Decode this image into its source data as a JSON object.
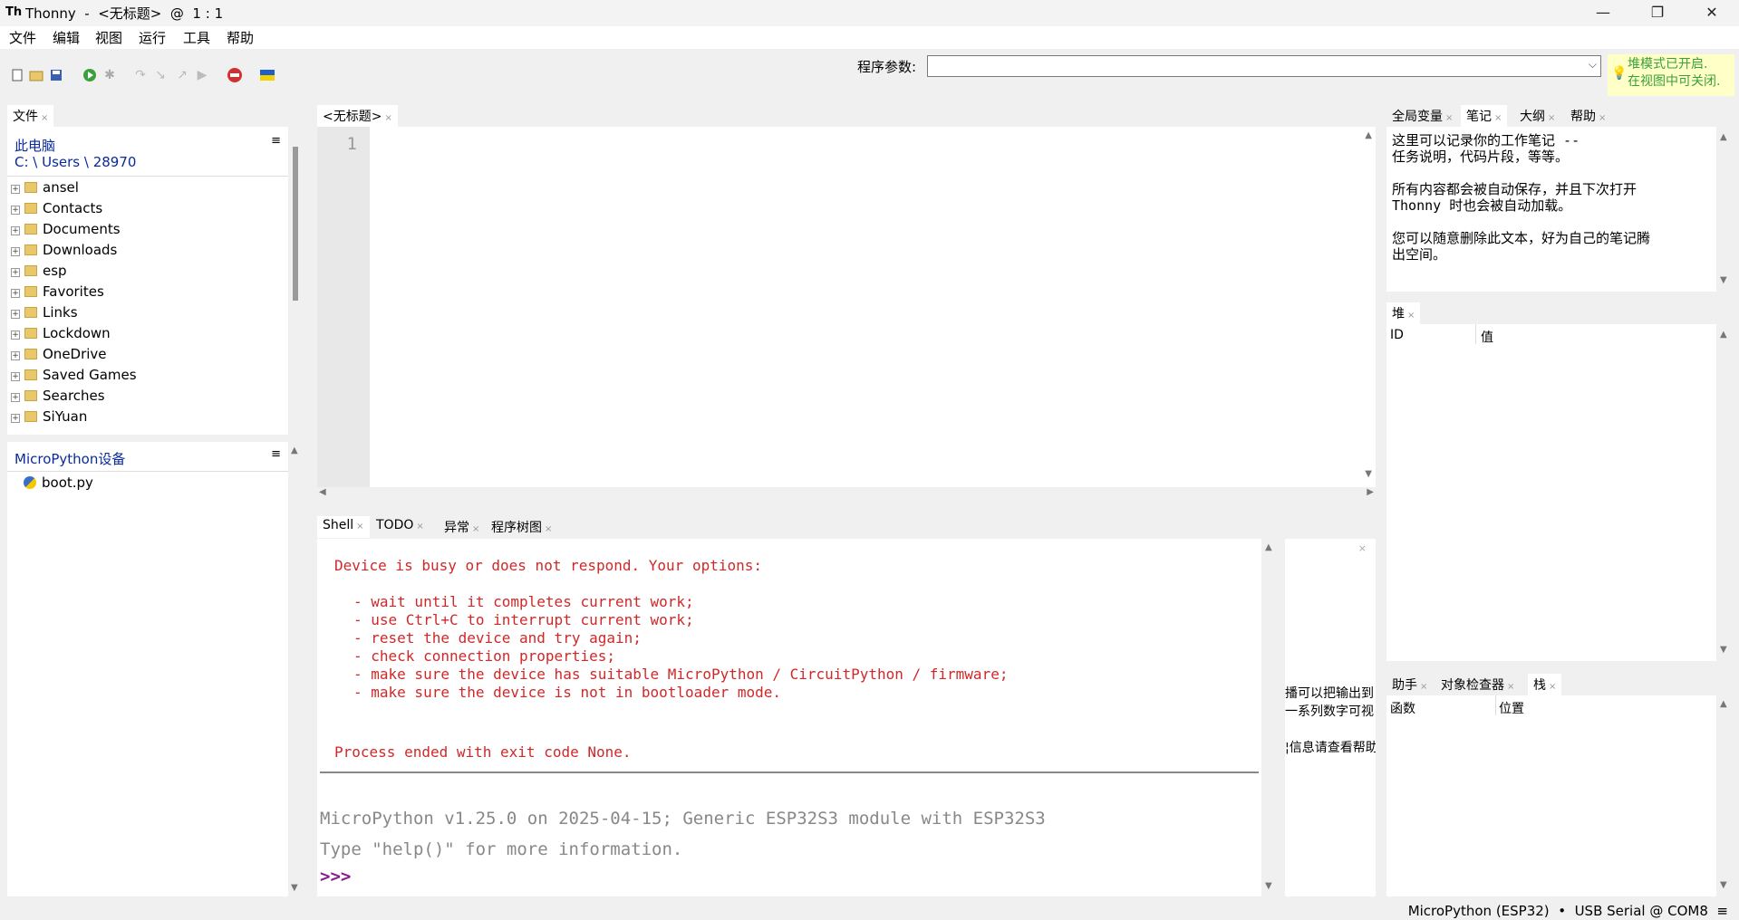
{
  "window": {
    "app_name": "Thonny",
    "title": "Thonny  -  <无标题>  @  1 : 1",
    "minimize": "—",
    "maximize": "❐",
    "close": "✕"
  },
  "menu": [
    "文件",
    "编辑",
    "视图",
    "运行",
    "工具",
    "帮助"
  ],
  "toolbar": {
    "args_label": "程序参数:",
    "args_value": "",
    "heap_note_line1": "堆模式已开启.",
    "heap_note_line2": "在视图中可关闭."
  },
  "files_panel": {
    "tab": "文件",
    "computer_label": "此电脑",
    "path": "C: \\ Users \\ 28970",
    "folders": [
      "ansel",
      "Contacts",
      "Documents",
      "Downloads",
      "esp",
      "Favorites",
      "Links",
      "Lockdown",
      "OneDrive",
      "Saved Games",
      "Searches",
      "SiYuan"
    ],
    "device_label": "MicroPython设备",
    "device_files": [
      "boot.py"
    ],
    "menu_icon": "≡"
  },
  "editor": {
    "tab": "<无标题>",
    "line_number": "1"
  },
  "shell_tabs": [
    "Shell",
    "TODO",
    "异常",
    "程序树图"
  ],
  "shell": {
    "error_title": "Device is busy or does not respond. Your options:",
    "options": [
      "- wait until it completes current work;",
      "- use Ctrl+C to interrupt current work;",
      "- reset the device and try again;",
      "- check connection properties;",
      "- make sure the device has suitable MicroPython / CircuitPython / firmware;",
      "- make sure the device is not in bootloader mode."
    ],
    "process_end": "Process ended with exit code None.",
    "banner1": "MicroPython v1.25.0 on 2025-04-15; Generic ESP32S3 module with ESP32S3",
    "banner2": "Type \"help()\" for more information.",
    "prompt": ">>>"
  },
  "plotter_hint": {
    "line1": "播可以把输出到",
    "line2": "一系列数字可视",
    "line3": "¦信息请查看帮助"
  },
  "right_top_tabs": [
    "全局变量",
    "笔记",
    "大纲",
    "帮助"
  ],
  "notes": {
    "line1": "这里可以记录你的工作笔记 --",
    "line2": "任务说明，代码片段，等等。",
    "line3": "所有内容都会被自动保存，并且下次打开",
    "line4": "Thonny 时也会被自动加载。",
    "line5": "您可以随意删除此文本，好为自己的笔记腾",
    "line6": "出空间。"
  },
  "heap_panel": {
    "tab": "堆",
    "col_id": "ID",
    "col_value": "值"
  },
  "right_bottom_tabs": [
    "助手",
    "对象检查器",
    "栈"
  ],
  "stack_panel": {
    "col_function": "函数",
    "col_location": "位置"
  },
  "status": {
    "text": "MicroPython (ESP32)  •  USB Serial @ COM8  ≡"
  }
}
